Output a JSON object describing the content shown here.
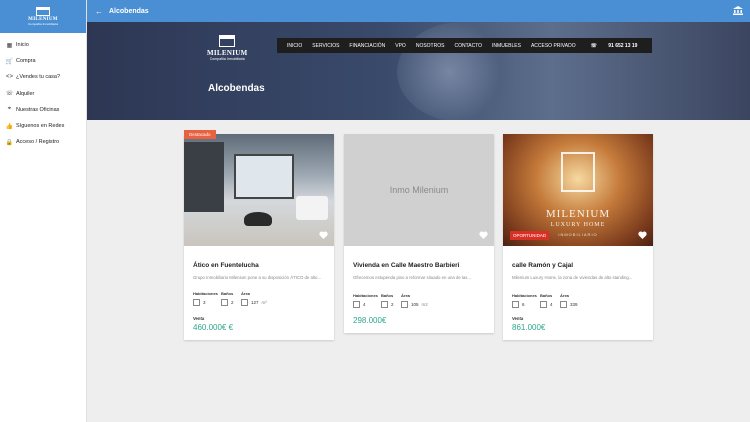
{
  "topbar": {
    "title": "Alcobendas",
    "back_icon": "arrow-left-icon",
    "right_icon": "bank-icon"
  },
  "sidebar": {
    "logo_title": "MILENIUM",
    "logo_sub": "Compañía Inmobiliaria",
    "items": [
      {
        "label": "Inicio",
        "icon": "grid-icon"
      },
      {
        "label": "Compra",
        "icon": "cart-icon"
      },
      {
        "label": "¿Vendes tu casa?",
        "icon": "code-icon"
      },
      {
        "label": "Alquiler",
        "icon": "phone-icon"
      },
      {
        "label": "Nuestras Oficinas",
        "icon": "location-icon"
      },
      {
        "label": "Síguenos en Redes",
        "icon": "thumbs-up-icon"
      },
      {
        "label": "Acceso / Registro",
        "icon": "lock-icon"
      }
    ]
  },
  "hero": {
    "logo_title": "MILENIUM",
    "logo_sub": "Compañía Inmobiliaria",
    "nav": [
      "INICIO",
      "SERVICIOS",
      "FINANCIACIÓN",
      "VPO",
      "NOSOTROS",
      "CONTACTO",
      "INMUEBLES",
      "ACCESO PRIVADO"
    ],
    "phone": "91 652 13 19",
    "title": "Alcobendas"
  },
  "cards": [
    {
      "ribbon": "Destacado",
      "title": "Ático en Fuentelucha",
      "desc": "Grupo Inmobiliario Milenium pone a su disposición ÁTICO de alto...",
      "features": {
        "hab_label": "Habitaciones",
        "banos_label": "Baños",
        "area_label": "Área",
        "hab": "3",
        "banos": "2",
        "area": "127",
        "unit": "m²"
      },
      "venta_label": "Venta",
      "price": "460.000€ €"
    },
    {
      "placeholder": "Inmo Milenium",
      "title": "Vivienda en Calle Maestro Barbieri",
      "desc": "Ofrecemos estupenda piso a reformar situado en una de las...",
      "features": {
        "hab_label": "Habitaciones",
        "banos_label": "Baños",
        "area_label": "Área",
        "hab": "4",
        "banos": "2",
        "area": "105",
        "unit": "m2"
      },
      "venta_label": "",
      "price": "298.000€"
    },
    {
      "badge": "OPORTUNIDAD",
      "overlay_title": "MILENIUM",
      "overlay_sub": "LUXURY HOME",
      "overlay_sub2": "INMOBILIARIO",
      "title": "calle Ramón y Cajal",
      "desc": "Milenium Luxury Home, la zona de viviendas de alto standing...",
      "features": {
        "hab_label": "Habitaciones",
        "banos_label": "Baños",
        "area_label": "Área",
        "hab": "6",
        "banos": "4",
        "area": "339",
        "unit": ""
      },
      "venta_label": "Venta",
      "price": "861.000€"
    }
  ]
}
